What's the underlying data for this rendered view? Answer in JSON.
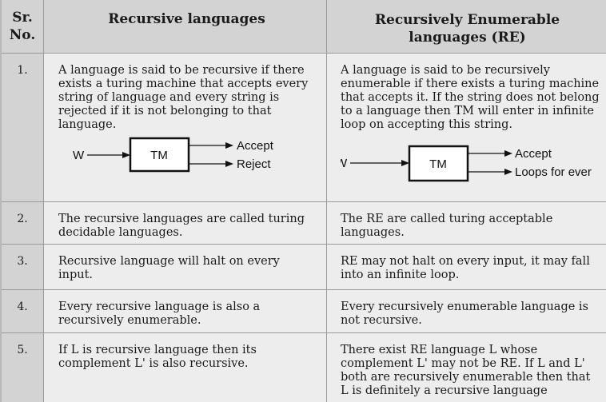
{
  "header": {
    "sr_no": "Sr.\nNo.",
    "col_recursive": "Recursive languages",
    "col_re": "Recursively Enumerable languages (RE)"
  },
  "rows": [
    {
      "sr": "1.",
      "recursive": "A language is said to be recursive if there exists a turing machine that accepts every string of language and every string is rejected if it is not belonging to that language.",
      "re": "A language is said to be recursively enumerable if there exists a turing machine that accepts it. If the string does not belong to a language then TM will enter in infinite loop on accepting this string.",
      "diagram_recursive": {
        "input": "W",
        "box": "TM",
        "out1": "Accept",
        "out2": "Reject"
      },
      "diagram_re": {
        "input": "W",
        "box": "TM",
        "out1": "Accept",
        "out2": "Loops for ever"
      }
    },
    {
      "sr": "2.",
      "recursive": "The recursive languages are called turing decidable languages.",
      "re": "The RE are called turing acceptable languages."
    },
    {
      "sr": "3.",
      "recursive": "Recursive language will halt on every input.",
      "re": "RE may not halt on every input, it may fall into an infinite loop."
    },
    {
      "sr": "4.",
      "recursive": "Every recursive language is also a recursively enumerable.",
      "re": "Every recursively enumerable language is not recursive."
    },
    {
      "sr": "5.",
      "recursive": "If L is recursive language then its complement L' is also recursive.",
      "re": "There exist RE language L whose complement L' may not be RE. If L and L' both are recursively enumerable then that L is definitely a recursive language"
    }
  ]
}
